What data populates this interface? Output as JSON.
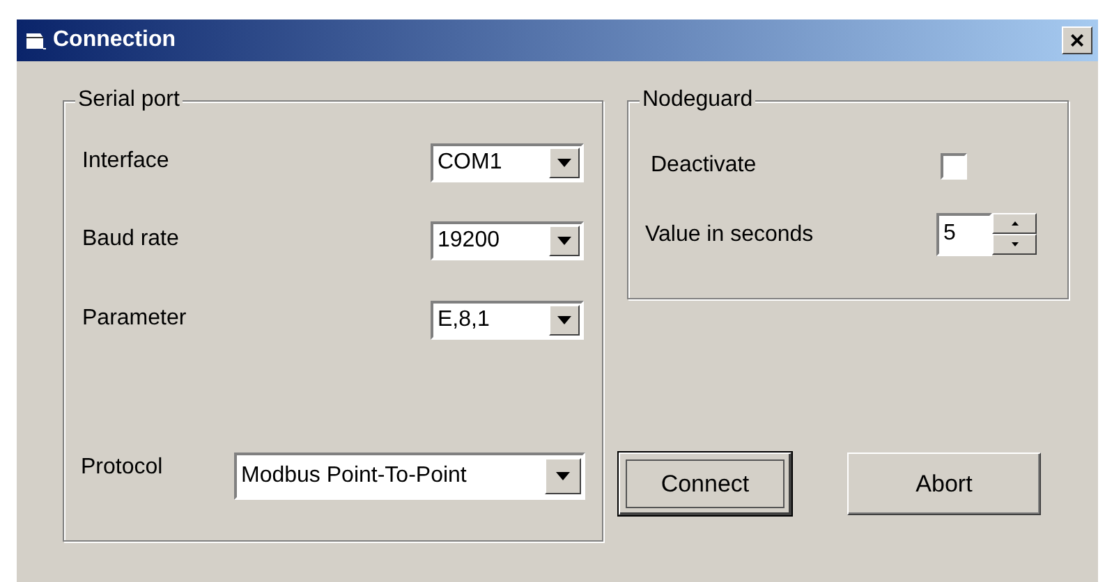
{
  "window": {
    "title": "Connection",
    "close": "×"
  },
  "serial_port": {
    "title": "Serial port",
    "fields": [
      {
        "label": "Interface",
        "value": "COM1"
      },
      {
        "label": "Baud rate",
        "value": "19200"
      },
      {
        "label": "Parameter",
        "value": "E,8,1"
      }
    ],
    "protocol": {
      "label": "Protocol",
      "value": "Modbus Point-To-Point"
    }
  },
  "nodeguard": {
    "title": "Nodeguard",
    "deactivate": {
      "label": "Deactivate",
      "checked": false
    },
    "seconds": {
      "label": "Value in seconds",
      "value": "5"
    }
  },
  "buttons": [
    {
      "label": "Connect",
      "focused": true
    },
    {
      "label": "Abort",
      "focused": false
    }
  ]
}
